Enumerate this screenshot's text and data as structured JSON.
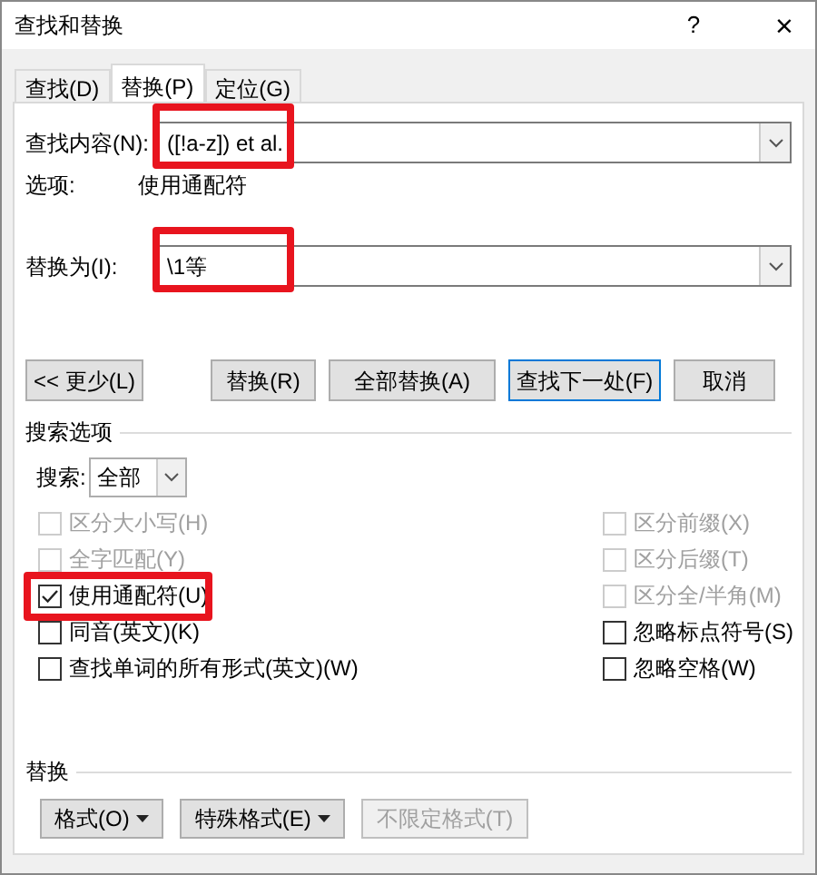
{
  "window": {
    "title": "查找和替换",
    "help": "?",
    "close": "×"
  },
  "tabs": [
    {
      "label": "查找(D)",
      "selected": false
    },
    {
      "label": "替换(P)",
      "selected": true
    },
    {
      "label": "定位(G)",
      "selected": false
    }
  ],
  "find": {
    "label": "查找内容(N):",
    "value": "([!a-z]) et al.",
    "highlighted": true
  },
  "options_line": {
    "label": "选项:",
    "value": "使用通配符"
  },
  "replace": {
    "label": "替换为(I):",
    "value": "\\1等",
    "highlighted": true
  },
  "buttons": [
    {
      "label": "<< 更少(L)",
      "kind": "normal"
    },
    {
      "label": "替换(R)",
      "kind": "normal"
    },
    {
      "label": "全部替换(A)",
      "kind": "normal"
    },
    {
      "label": "查找下一处(F)",
      "kind": "default"
    },
    {
      "label": "取消",
      "kind": "normal"
    }
  ],
  "search_options": {
    "heading": "搜索选项",
    "search_label": "搜索:",
    "search_value": "全部",
    "left": [
      {
        "label": "区分大小写(H)",
        "checked": false,
        "disabled": true,
        "highlighted": false
      },
      {
        "label": "全字匹配(Y)",
        "checked": false,
        "disabled": true,
        "highlighted": false
      },
      {
        "label": "使用通配符(U)",
        "checked": true,
        "disabled": false,
        "highlighted": true
      },
      {
        "label": "同音(英文)(K)",
        "checked": false,
        "disabled": false,
        "highlighted": false
      },
      {
        "label": "查找单词的所有形式(英文)(W)",
        "checked": false,
        "disabled": false,
        "highlighted": false
      }
    ],
    "right": [
      {
        "label": "区分前缀(X)",
        "checked": false,
        "disabled": true,
        "highlighted": false
      },
      {
        "label": "区分后缀(T)",
        "checked": false,
        "disabled": true,
        "highlighted": false
      },
      {
        "label": "区分全/半角(M)",
        "checked": false,
        "disabled": true,
        "highlighted": false
      },
      {
        "label": "忽略标点符号(S)",
        "checked": false,
        "disabled": false,
        "highlighted": false
      },
      {
        "label": "忽略空格(W)",
        "checked": false,
        "disabled": false,
        "highlighted": false
      }
    ]
  },
  "replace_section": {
    "heading": "替换",
    "buttons": [
      {
        "label": "格式(O)",
        "dropdown": true,
        "disabled": false
      },
      {
        "label": "特殊格式(E)",
        "dropdown": true,
        "disabled": false
      },
      {
        "label": "不限定格式(T)",
        "dropdown": false,
        "disabled": true
      }
    ]
  }
}
